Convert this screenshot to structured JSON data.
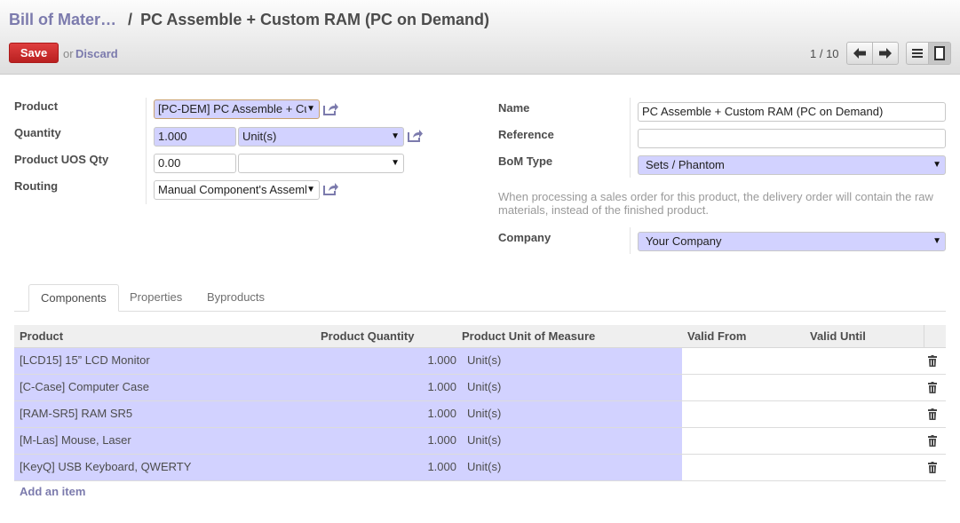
{
  "header": {
    "breadcrumb_parent": "Bill of Mater…",
    "breadcrumb_sep": "/",
    "breadcrumb_current": "PC Assemble + Custom RAM (PC on Demand)",
    "save_label": "Save",
    "or_label": "or",
    "discard_label": "Discard",
    "pager_text": "1 / 10"
  },
  "form": {
    "product": {
      "label": "Product",
      "value": "[PC-DEM] PC Assemble + Custom RAM (PC on Demand)"
    },
    "quantity": {
      "label": "Quantity",
      "value": "1.000",
      "uom": "Unit(s)"
    },
    "uos_qty": {
      "label": "Product UOS Qty",
      "value": "0.00",
      "uos": ""
    },
    "routing": {
      "label": "Routing",
      "value": "Manual Component's Assembly"
    },
    "name": {
      "label": "Name",
      "value": "PC Assemble + Custom RAM (PC on Demand)"
    },
    "reference": {
      "label": "Reference",
      "value": ""
    },
    "bom_type": {
      "label": "BoM Type",
      "value": "Sets / Phantom"
    },
    "bom_type_help": "When processing a sales order for this product, the delivery order will contain the raw materials, instead of the finished product.",
    "company": {
      "label": "Company",
      "value": "Your Company"
    }
  },
  "tabs": [
    {
      "label": "Components"
    },
    {
      "label": "Properties"
    },
    {
      "label": "Byproducts"
    }
  ],
  "table": {
    "columns": [
      "Product",
      "Product Quantity",
      "Product Unit of Measure",
      "Valid From",
      "Valid Until"
    ],
    "rows": [
      {
        "product": "[LCD15] 15” LCD Monitor",
        "qty": "1.000",
        "uom": "Unit(s)",
        "from": "",
        "until": ""
      },
      {
        "product": "[C-Case] Computer Case",
        "qty": "1.000",
        "uom": "Unit(s)",
        "from": "",
        "until": ""
      },
      {
        "product": "[RAM-SR5] RAM SR5",
        "qty": "1.000",
        "uom": "Unit(s)",
        "from": "",
        "until": ""
      },
      {
        "product": "[M-Las] Mouse, Laser",
        "qty": "1.000",
        "uom": "Unit(s)",
        "from": "",
        "until": ""
      },
      {
        "product": "[KeyQ] USB Keyboard, QWERTY",
        "qty": "1.000",
        "uom": "Unit(s)",
        "from": "",
        "until": ""
      }
    ],
    "add_item_label": "Add an item"
  },
  "colors": {
    "accent": "#7c7bad",
    "save": "#c62d2d",
    "required_field": "#d2d2ff"
  },
  "icons": [
    "arrow-left-icon",
    "arrow-right-icon",
    "list-view-icon",
    "form-view-icon",
    "external-link-icon",
    "trash-icon"
  ]
}
